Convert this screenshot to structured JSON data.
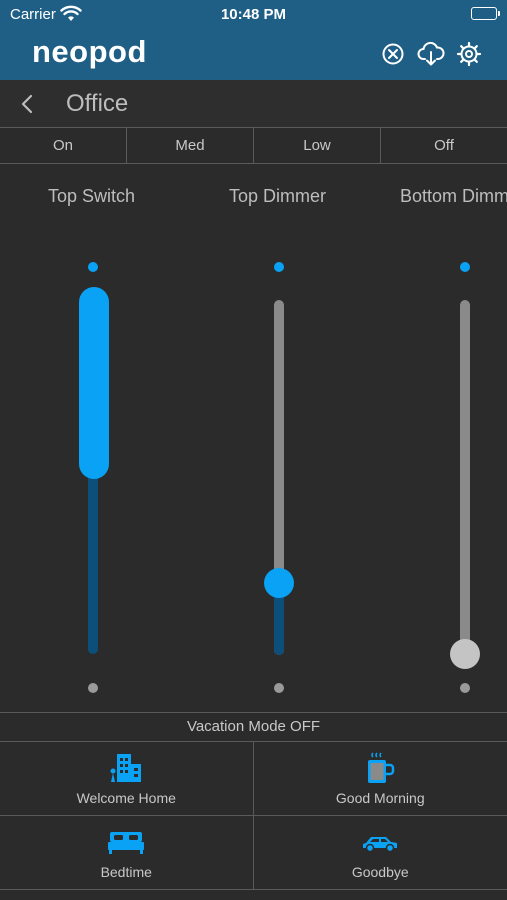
{
  "status_bar": {
    "carrier": "Carrier",
    "time": "10:48 PM"
  },
  "header": {
    "logo": "neopod",
    "icons": [
      "close-circle-icon",
      "cloud-download-icon",
      "gear-icon"
    ]
  },
  "title_bar": {
    "title": "Office"
  },
  "presets": [
    "On",
    "Med",
    "Low",
    "Off"
  ],
  "sliders": [
    {
      "label": "Top Switch",
      "level": 1.0
    },
    {
      "label": "Top Dimmer",
      "level": 0.2
    },
    {
      "label": "Bottom Dimmer",
      "level": 0.0
    }
  ],
  "vacation": {
    "label": "Vacation Mode OFF"
  },
  "scenes": [
    {
      "label": "Welcome Home",
      "icon": "building-icon"
    },
    {
      "label": "Good Morning",
      "icon": "coffee-mug-icon"
    },
    {
      "label": "Bedtime",
      "icon": "bed-icon"
    },
    {
      "label": "Goodbye",
      "icon": "car-icon"
    }
  ],
  "colors": {
    "accent": "#0aa2f5",
    "header": "#1f5f86",
    "background": "#2b2b2b",
    "track_dark": "#0b4f7a",
    "track_grey": "#8a8a8a"
  }
}
